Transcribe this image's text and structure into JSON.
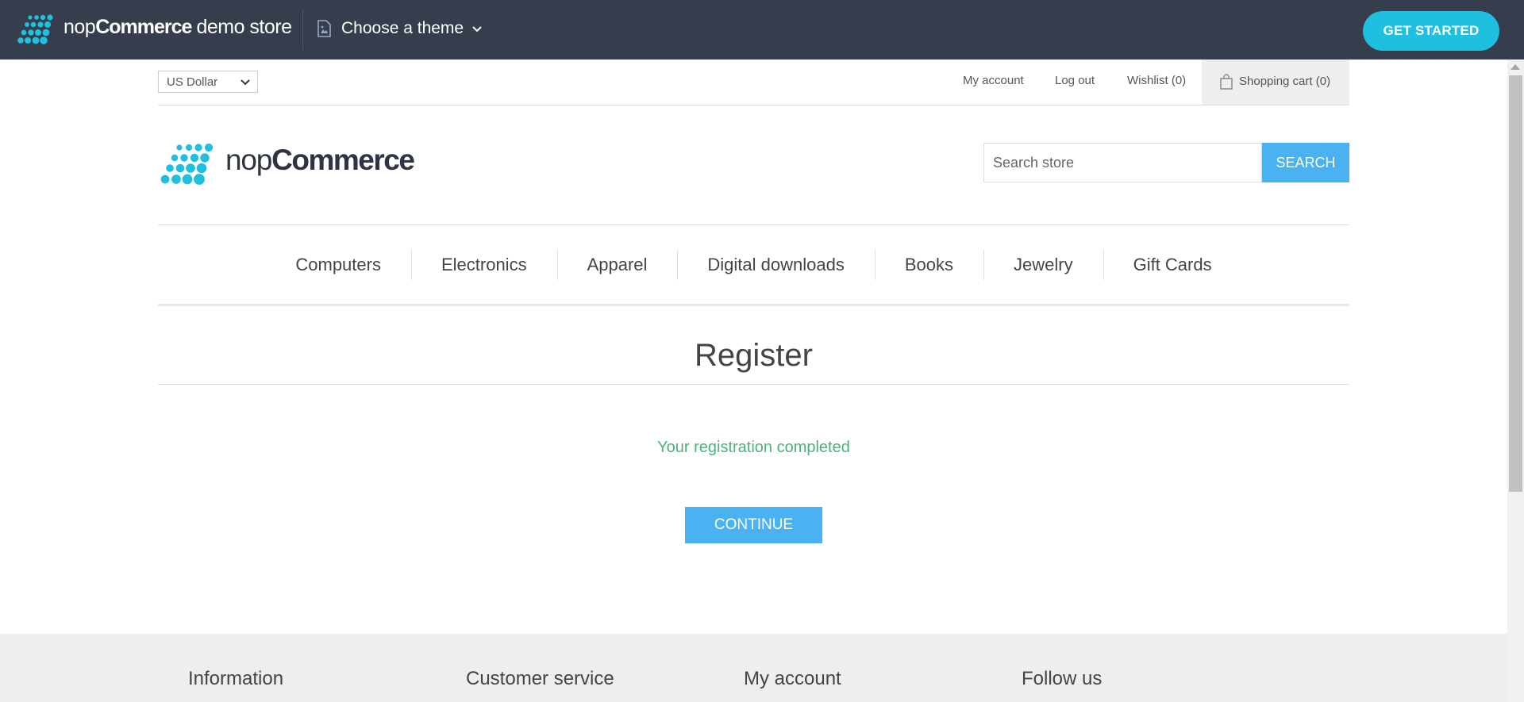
{
  "demo_bar": {
    "brand_part1": "nop",
    "brand_part2": "Commerce",
    "brand_part3": "demo store",
    "theme_label": "Choose a theme",
    "get_started": "GET STARTED"
  },
  "header": {
    "currency": "US Dollar",
    "links": {
      "my_account": "My account",
      "log_out": "Log out",
      "wishlist": "Wishlist (0)",
      "shopping_cart": "Shopping cart (0)"
    }
  },
  "logo": {
    "part1": "nop",
    "part2": "Commerce"
  },
  "search": {
    "placeholder": "Search store",
    "button": "SEARCH"
  },
  "menu": {
    "items": [
      "Computers",
      "Electronics",
      "Apparel",
      "Digital downloads",
      "Books",
      "Jewelry",
      "Gift Cards"
    ]
  },
  "page": {
    "title": "Register",
    "result": "Your registration completed",
    "continue": "CONTINUE"
  },
  "footer": {
    "headings": [
      "Information",
      "Customer service",
      "My account",
      "Follow us"
    ]
  },
  "colors": {
    "demo_bar_bg": "#363d4d",
    "accent_cyan": "#1ebfdf",
    "button_blue": "#4ab2f1",
    "success_green": "#4cb17c",
    "footer_bg": "#eeeeee"
  }
}
